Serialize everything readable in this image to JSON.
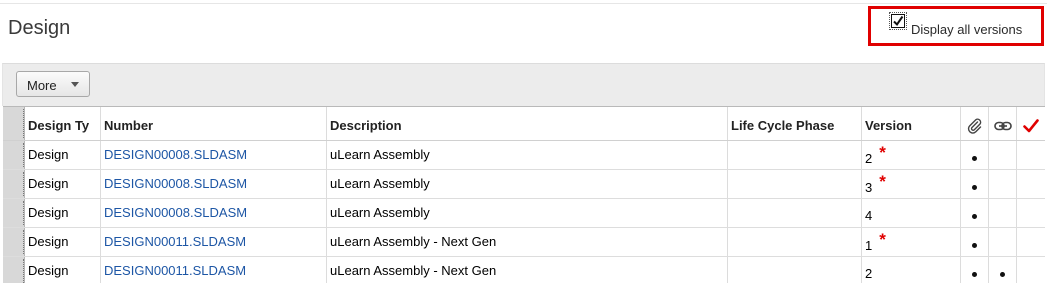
{
  "page": {
    "title": "Design"
  },
  "versions_toggle": {
    "label": "Display all versions",
    "checked": true,
    "highlight_color": "#e00000"
  },
  "toolbar": {
    "more_label": "More"
  },
  "table": {
    "columns": {
      "type": "Design Ty",
      "number": "Number",
      "description": "Description",
      "life_cycle_phase": "Life Cycle Phase",
      "version": "Version",
      "attachment_icon": "paperclip-icon",
      "link_icon": "link-icon",
      "check_icon": "checkmark-icon"
    },
    "rows": [
      {
        "type": "Design",
        "number": "DESIGN00008.SLDASM",
        "description": "uLearn Assembly",
        "life_cycle_phase": "",
        "version": "2",
        "version_marker": "*",
        "attachment": true,
        "link": false,
        "check": false
      },
      {
        "type": "Design",
        "number": "DESIGN00008.SLDASM",
        "description": "uLearn Assembly",
        "life_cycle_phase": "",
        "version": "3",
        "version_marker": "*",
        "attachment": true,
        "link": false,
        "check": false
      },
      {
        "type": "Design",
        "number": "DESIGN00008.SLDASM",
        "description": "uLearn Assembly",
        "life_cycle_phase": "",
        "version": "4",
        "version_marker": "",
        "attachment": true,
        "link": false,
        "check": false
      },
      {
        "type": "Design",
        "number": "DESIGN00011.SLDASM",
        "description": "uLearn Assembly - Next Gen",
        "life_cycle_phase": "",
        "version": "1",
        "version_marker": "*",
        "attachment": true,
        "link": false,
        "check": false
      },
      {
        "type": "Design",
        "number": "DESIGN00011.SLDASM",
        "description": "uLearn Assembly - Next Gen",
        "life_cycle_phase": "",
        "version": "2",
        "version_marker": "",
        "attachment": true,
        "link": true,
        "check": false
      }
    ]
  },
  "colors": {
    "link": "#1d56a5",
    "marker": "#e00000",
    "check": "#e00000"
  }
}
